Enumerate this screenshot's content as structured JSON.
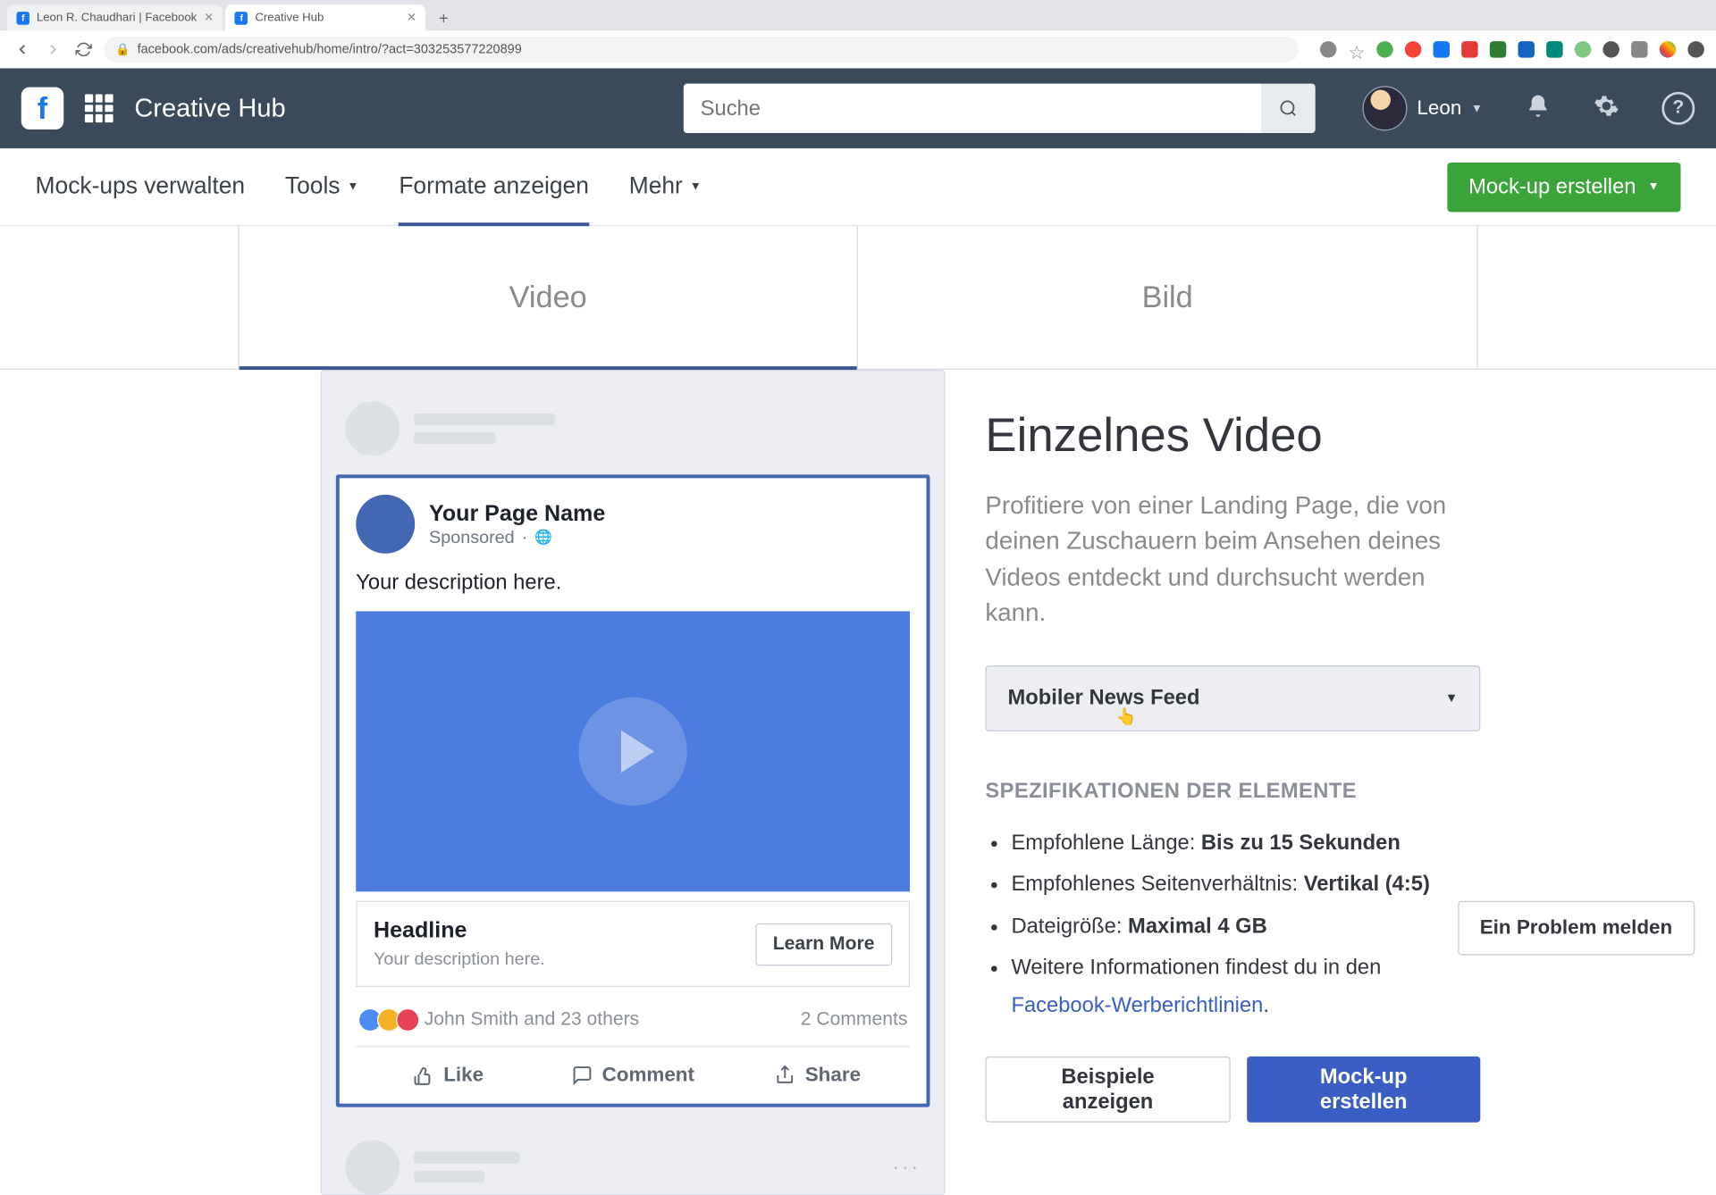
{
  "browser": {
    "tab1": "Leon R. Chaudhari | Facebook",
    "tab2": "Creative Hub",
    "url": "facebook.com/ads/creativehub/home/intro/?act=303253577220899"
  },
  "nav": {
    "hub_title": "Creative Hub",
    "search_placeholder": "Suche",
    "user_name": "Leon"
  },
  "subnav": {
    "manage": "Mock-ups verwalten",
    "tools": "Tools",
    "formats": "Formate anzeigen",
    "more": "Mehr",
    "create_btn": "Mock-up erstellen"
  },
  "format_tabs": {
    "video": "Video",
    "image": "Bild"
  },
  "ad": {
    "page_name": "Your Page Name",
    "sponsored": "Sponsored",
    "description": "Your description here.",
    "headline": "Headline",
    "subline": "Your description here.",
    "cta": "Learn More",
    "reactions_text": "John Smith and 23 others",
    "comments": "2 Comments",
    "like": "Like",
    "comment": "Comment",
    "share": "Share"
  },
  "info": {
    "title": "Einzelnes Video",
    "desc": "Profitiere von einer Landing Page, die von deinen Zuschauern beim Ansehen deines Videos entdeckt und durchsucht werden kann.",
    "dropdown": "Mobiler News Feed",
    "spec_title": "SPEZIFIKATIONEN DER ELEMENTE",
    "spec1_label": "Empfohlene Länge: ",
    "spec1_value": "Bis zu 15 Sekunden",
    "spec2_label": "Empfohlenes Seitenverhältnis: ",
    "spec2_value": "Vertikal (4:5)",
    "spec3_label": "Dateigröße: ",
    "spec3_value": "Maximal 4 GB",
    "spec4_prefix": "Weitere Informationen findest du in den ",
    "spec4_link": "Facebook-Werberichtlinien",
    "btn_examples": "Beispiele anzeigen",
    "btn_create": "Mock-up erstellen"
  },
  "report_btn": "Ein Problem melden"
}
